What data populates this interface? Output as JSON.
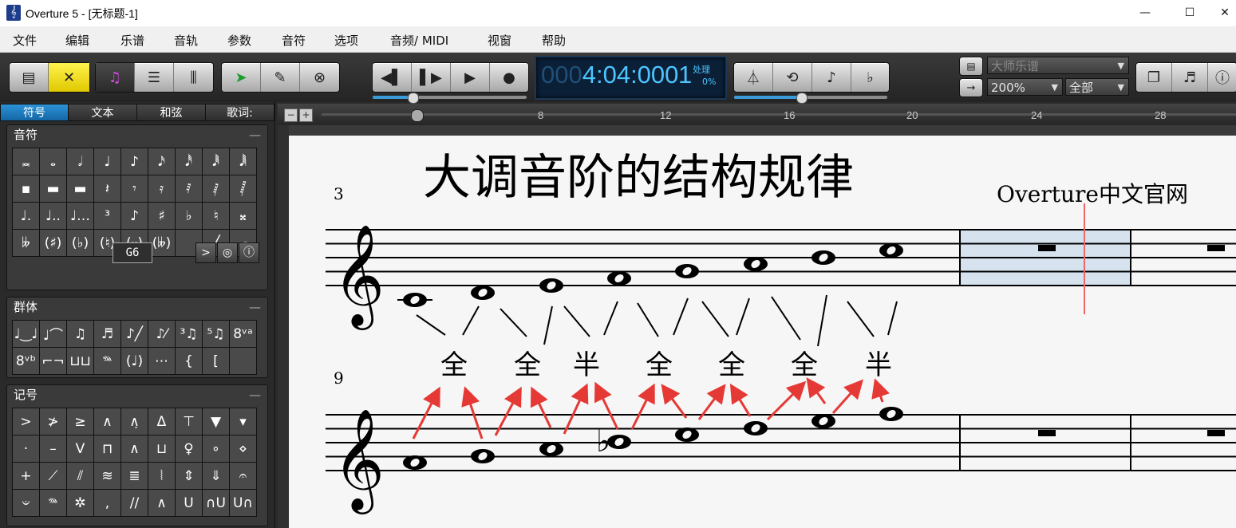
{
  "window": {
    "title": "Overture 5 - [无标题-1]",
    "app_icon": "treble-clef-icon"
  },
  "window_controls": {
    "minimize": "—",
    "maximize": "☐",
    "close": "✕"
  },
  "menu": [
    "文件",
    "编辑",
    "乐谱",
    "音轨",
    "参数",
    "音符",
    "选项",
    "音频/ MIDI",
    "视窗",
    "帮助"
  ],
  "transport": {
    "counter_dim": "000",
    "counter": "4:04:000",
    "measure": "1",
    "status": "处理",
    "percent": "0%"
  },
  "view": {
    "mode": "大师乐谱",
    "zoom": "200%",
    "track": "全部"
  },
  "palette_tabs": [
    "符号",
    "文本",
    "和弦",
    "歌词:"
  ],
  "palette_sections": {
    "notes": {
      "title": "音符",
      "pitch": "G6"
    },
    "tuplets": {
      "title": "群体"
    },
    "marks": {
      "title": "记号"
    }
  },
  "ruler": {
    "ticks": [
      "8",
      "12",
      "16",
      "20",
      "24",
      "28"
    ]
  },
  "score": {
    "title": "大调音阶的结构规律",
    "subtitle": "Overture中文官网",
    "measure_numbers": [
      "3",
      "9"
    ],
    "steps": [
      "全",
      "全",
      "半",
      "全",
      "全",
      "全",
      "半"
    ]
  },
  "colors": {
    "accent_blue": "#2c93d6",
    "lcd_text": "#4cc5ff",
    "arrow_red": "#e53935",
    "selection": "#d6e2ee"
  }
}
